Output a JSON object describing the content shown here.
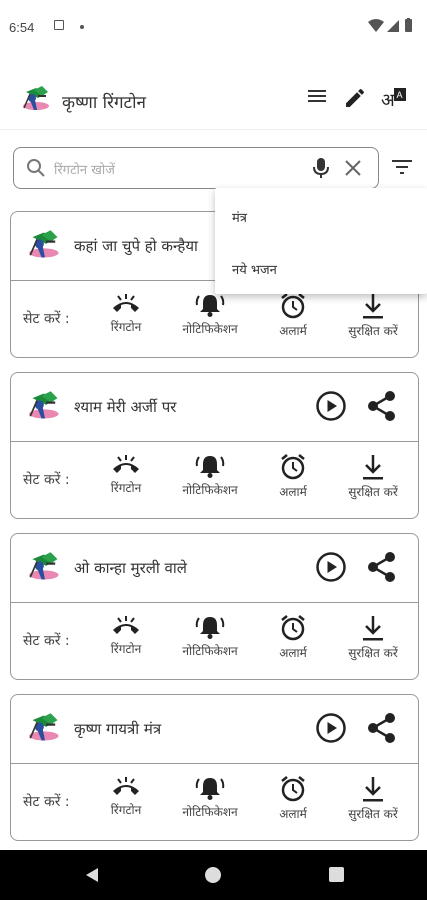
{
  "status_bar": {
    "time": "6:54"
  },
  "app_bar": {
    "title": "कृष्णा रिंगटोन"
  },
  "search": {
    "placeholder": "रिंगटोन खोजें"
  },
  "dropdown": {
    "items": [
      "मंत्र",
      "नये भजन"
    ]
  },
  "card_common": {
    "set_label": "सेट करें :",
    "actions": [
      "रिंगटोन",
      "नोटिफिकेशन",
      "अलार्म",
      "सुरक्षित करें"
    ]
  },
  "cards": [
    {
      "title": "कहां जा चुपे हो कन्हैया"
    },
    {
      "title": "श्याम मेरी अर्जी पर"
    },
    {
      "title": "ओ कान्हा मुरली वाले"
    },
    {
      "title": "कृष्ण गायत्री मंत्र"
    }
  ],
  "colors": {
    "text": "#333333",
    "border": "#999999",
    "nav_bar": "#000000"
  },
  "icons": [
    "menu-icon",
    "edit-icon",
    "translate-icon",
    "search-icon",
    "mic-icon",
    "clear-icon",
    "filter-icon",
    "play-icon",
    "share-icon",
    "phone-ringtone-icon",
    "bell-icon",
    "alarm-clock-icon",
    "download-icon"
  ]
}
